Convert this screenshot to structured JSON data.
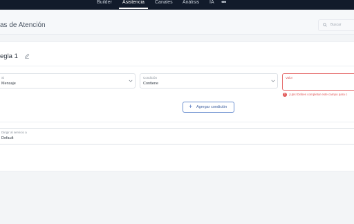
{
  "nav": {
    "items": [
      {
        "label": "Builder",
        "active": false
      },
      {
        "label": "Asistencia",
        "active": true
      },
      {
        "label": "Canales",
        "active": false
      },
      {
        "label": "Análisis",
        "active": false
      },
      {
        "label": "IA",
        "active": false
      }
    ],
    "more_icon": "more-horizontal-icon",
    "more_glyph": "•••"
  },
  "header": {
    "title": "as de Atención",
    "search": {
      "placeholder": "Buscar",
      "icon": "search-icon"
    }
  },
  "rule": {
    "title": "egla 1",
    "edit_icon": "pencil-icon",
    "conditions": [
      {
        "label": "Si",
        "value": "Mensaje",
        "type": "select"
      },
      {
        "label": "Condición",
        "value": "Contiene",
        "type": "select"
      },
      {
        "label": "Valor",
        "value": "",
        "type": "input",
        "error": true
      }
    ],
    "error_message": "¡Ups! Debes completar este campo para c",
    "add_condition_label": "Agregar condición",
    "service": {
      "label": "Dirigir al servicio a",
      "value": "Default"
    }
  },
  "colors": {
    "topbar": "#121b2b",
    "accent": "#4a6fbf",
    "error": "#e05555"
  }
}
